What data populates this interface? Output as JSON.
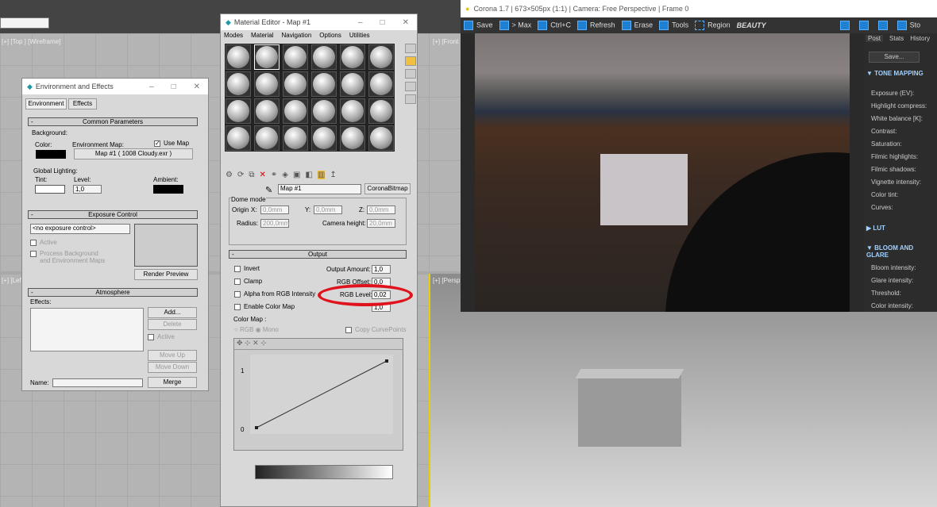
{
  "viewports": {
    "top": "[+] [Top ] [Wireframe]",
    "front": "[+] [Front",
    "left": "[+] [Left]",
    "persp": "[+] [Persp"
  },
  "env": {
    "title": "Environment and Effects",
    "tabs": [
      "Environment",
      "Effects"
    ],
    "common": "Common Parameters",
    "background": "Background:",
    "color": "Color:",
    "env_map": "Environment Map:",
    "use_map": "Use Map",
    "map_button": "Map #1 ( 1008 Cloudy.exr )",
    "global_lighting": "Global Lighting:",
    "tint": "Tint:",
    "level": "Level:",
    "level_value": "1,0",
    "ambient": "Ambient:",
    "exposure": "Exposure Control",
    "exposure_select": "<no exposure control>",
    "active": "Active",
    "process_bg": "Process Background",
    "process_bg2": "and Environment Maps",
    "render_preview": "Render Preview",
    "atmosphere": "Atmosphere",
    "effects": "Effects:",
    "add": "Add...",
    "delete": "Delete",
    "active2": "Active",
    "move_up": "Move Up",
    "move_down": "Move Down",
    "name": "Name:",
    "merge": "Merge"
  },
  "mat": {
    "title": "Material Editor - Map #1",
    "menu": [
      "Modes",
      "Material",
      "Navigation",
      "Options",
      "Utilities"
    ],
    "map_name": "Map #1",
    "map_type": "CoronaBitmap",
    "dome": "Dome mode",
    "origin": "Origin",
    "x": "X:",
    "y": "Y:",
    "z": "Z:",
    "x_val": "0,0mm",
    "y_val": "0,0mm",
    "z_val": "0,0mm",
    "radius": "Radius:",
    "radius_val": "200,0mm",
    "cam_height": "Camera height:",
    "cam_height_val": "20,0mm",
    "output": "Output",
    "invert": "Invert",
    "clamp": "Clamp",
    "alpha": "Alpha from RGB Intensity",
    "enable_cmap": "Enable Color Map",
    "output_amount": "Output Amount:",
    "output_amount_val": "1,0",
    "rgb_offset": "RGB Offset:",
    "rgb_offset_val": "0,0",
    "rgb_level": "RGB Level:",
    "rgb_level_val": "0,02",
    "bump_val": "1,0",
    "color_map": "Color Map :",
    "rgb": "RGB",
    "mono": "Mono",
    "copy": "Copy CurvePoints",
    "curve_y1": "1",
    "curve_y0": "0"
  },
  "corona": {
    "title": "Corona 1.7 | 673×505px (1:1) | Camera: Free Perspective | Frame 0",
    "toolbar": [
      "Save",
      "> Max",
      "Ctrl+C",
      "Refresh",
      "Erase",
      "Tools",
      "Region"
    ],
    "pass": "BEAUTY",
    "stop": "Sto",
    "tabs": [
      "Post",
      "Stats",
      "History"
    ],
    "save": "Save...",
    "tone": "TONE MAPPING",
    "tone_items": [
      "Exposure (EV):",
      "Highlight compress:",
      "White balance [K]:",
      "Contrast:",
      "Saturation:",
      "Filmic highlights:",
      "Filmic shadows:",
      "Vignette intensity:",
      "Color tint:",
      "Curves:"
    ],
    "lut": "LUT",
    "bloom": "BLOOM AND GLARE",
    "bloom_items": [
      "Bloom intensity:",
      "Glare intensity:",
      "Threshold:",
      "Color intensity:"
    ]
  },
  "colors": {
    "highlight": "#e0121b",
    "corona_accent": "#1f7fd0"
  }
}
